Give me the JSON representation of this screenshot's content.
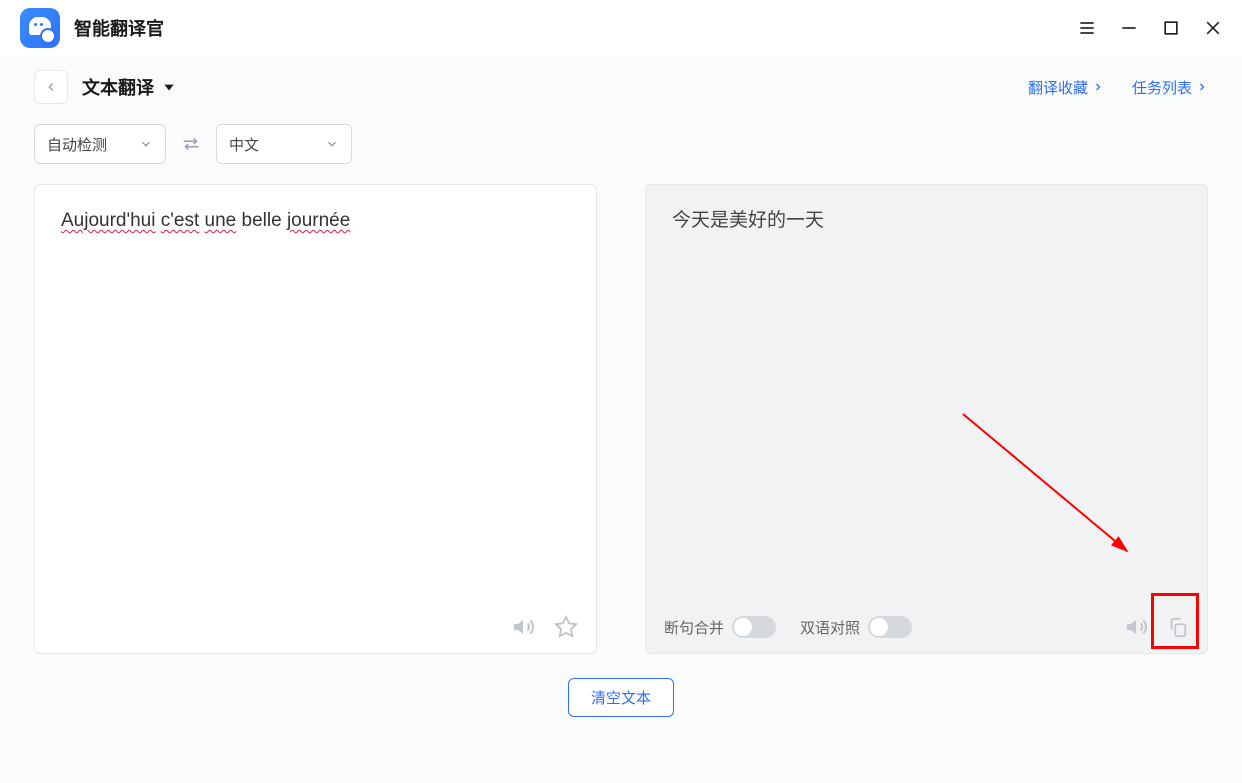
{
  "app_title": "智能翻译官",
  "subheader": {
    "mode_label": "文本翻译",
    "favorites_link": "翻译收藏",
    "tasks_link": "任务列表"
  },
  "lang": {
    "source": "自动检测",
    "target": "中文"
  },
  "input_text": "Aujourd'hui c'est une belle journée",
  "output_text": "今天是美好的一天",
  "toggles": {
    "merge_label": "断句合并",
    "bilingual_label": "双语对照"
  },
  "clear_button": "清空文本"
}
